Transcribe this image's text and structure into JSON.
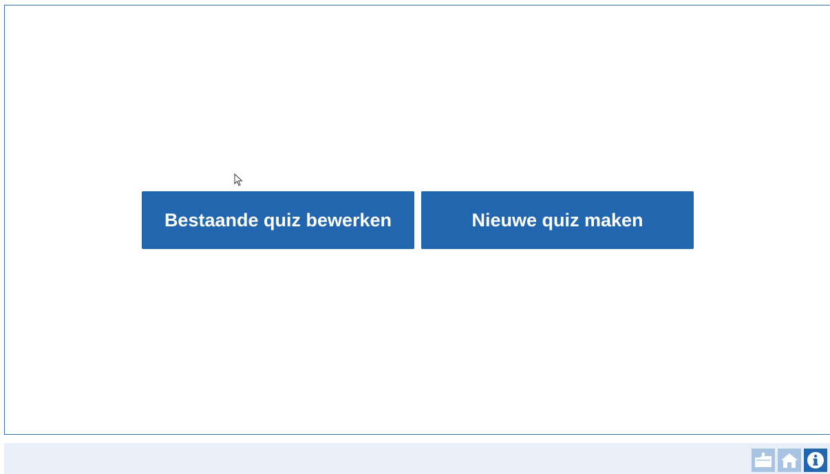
{
  "main": {
    "buttons": {
      "edit_existing_label": "Bestaande quiz bewerken",
      "new_quiz_label": "Nieuwe quiz maken"
    }
  },
  "footer": {
    "icons": [
      "folder-download-icon",
      "home-icon",
      "info-icon"
    ]
  },
  "colors": {
    "accent": "#2366b0",
    "border": "#2f6fb2",
    "footer_bg": "#e8eff8",
    "icon_light": "#a9c3e3"
  }
}
